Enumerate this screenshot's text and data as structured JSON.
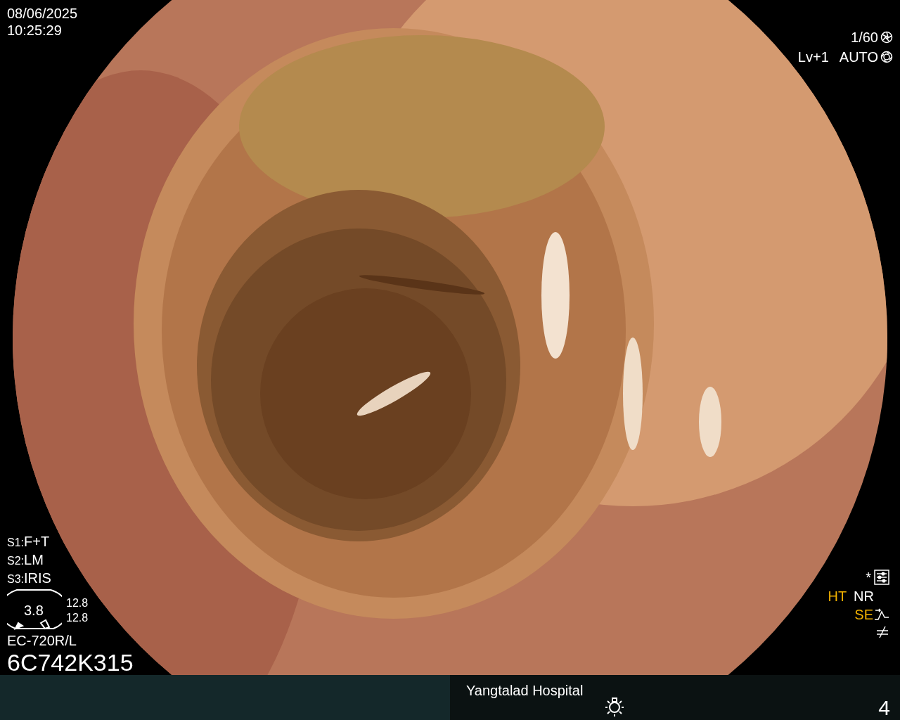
{
  "datetime": {
    "date": "08/06/2025",
    "time": "10:25:29"
  },
  "exposure": {
    "shutter": "1/60",
    "level": "Lv+1",
    "iris": "AUTO"
  },
  "settings": [
    {
      "key": "S1:",
      "value": "F+T"
    },
    {
      "key": "S2:",
      "value": "LM"
    },
    {
      "key": "S3:",
      "value": "IRIS"
    }
  ],
  "zoom_gauge": {
    "reading": "3.8",
    "values": [
      "12.8",
      "12.8"
    ]
  },
  "scope": {
    "model": "EC-720R/L",
    "serial": "6C742K315"
  },
  "enhancement": {
    "mark": "*",
    "row": [
      {
        "label": "HT",
        "active": true
      },
      {
        "label": "NR",
        "active": false
      }
    ],
    "se": {
      "label": "SE",
      "active": true
    }
  },
  "status_bar": {
    "hospital": "Yangtalad Hospital",
    "page": "4"
  }
}
